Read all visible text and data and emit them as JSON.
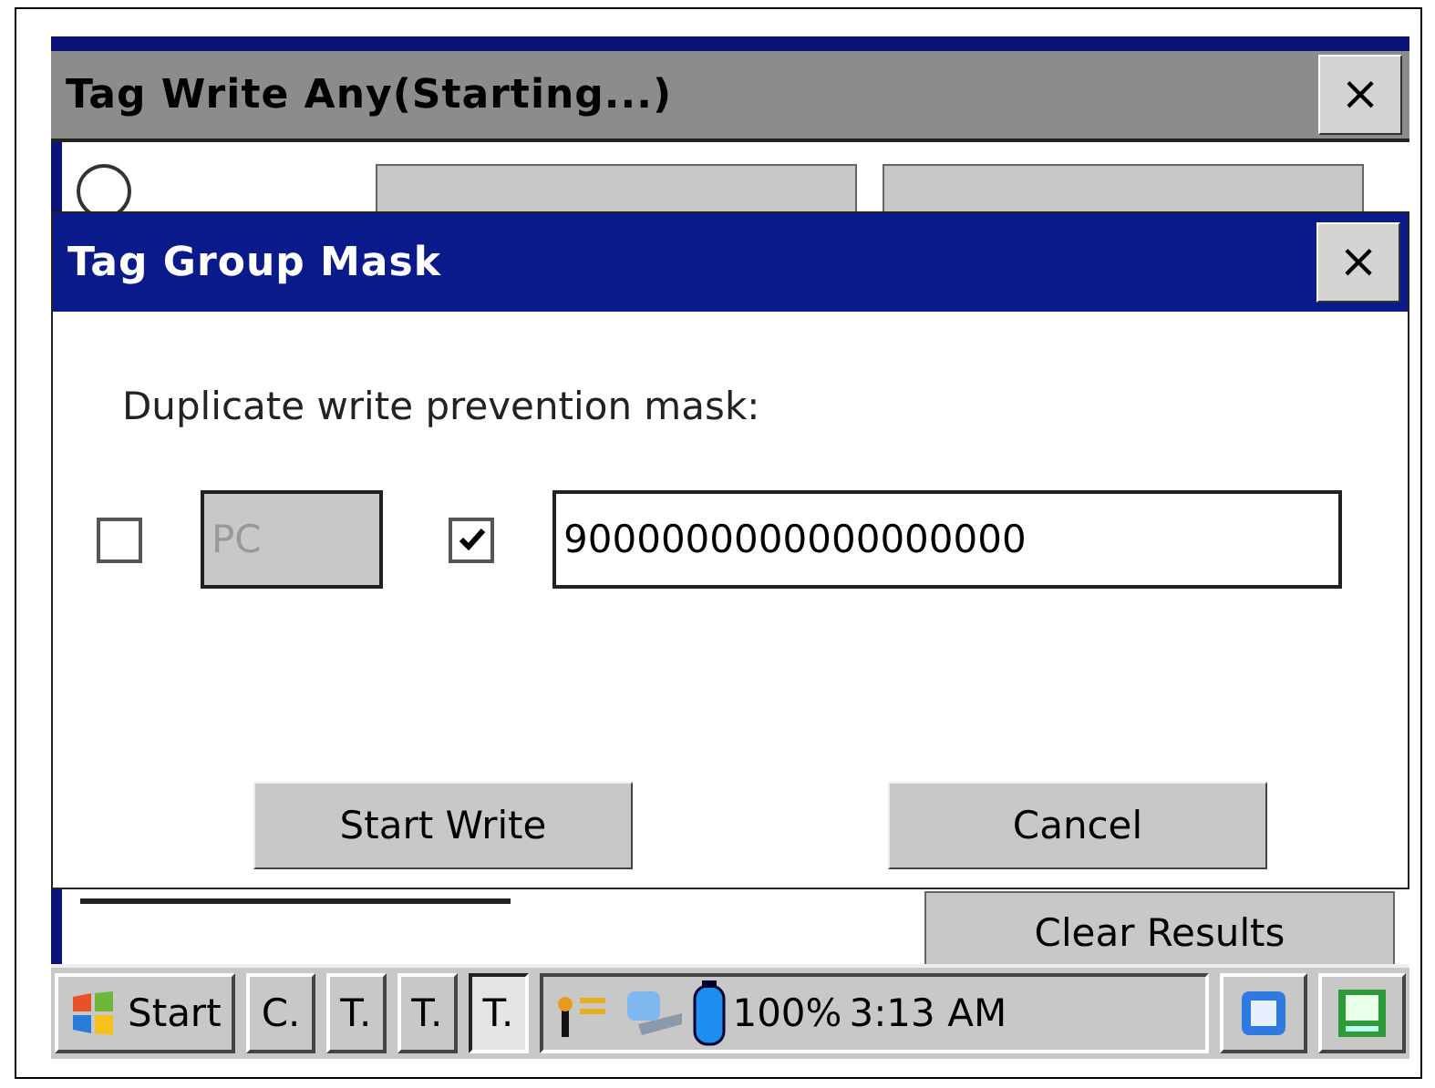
{
  "background_window": {
    "title": "Tag Write Any(Starting...)",
    "close": "×",
    "radio_selected": false,
    "clear_button": "Clear Results"
  },
  "dialog": {
    "title": "Tag Group Mask",
    "close": "×",
    "label": "Duplicate write prevention mask:",
    "fields": [
      {
        "checked": false,
        "value": "PC",
        "disabled": true
      },
      {
        "checked": true,
        "value": "9000000000000000000",
        "disabled": false
      }
    ],
    "buttons": [
      "Start Write",
      "Cancel"
    ]
  },
  "taskbar": {
    "start": "Start",
    "tasks": [
      {
        "label": "C.",
        "selected": false
      },
      {
        "label": "T.",
        "selected": false
      },
      {
        "label": "T.",
        "selected": false
      },
      {
        "label": "T.",
        "selected": true
      }
    ],
    "battery": "100%",
    "time": "3:13 AM"
  }
}
